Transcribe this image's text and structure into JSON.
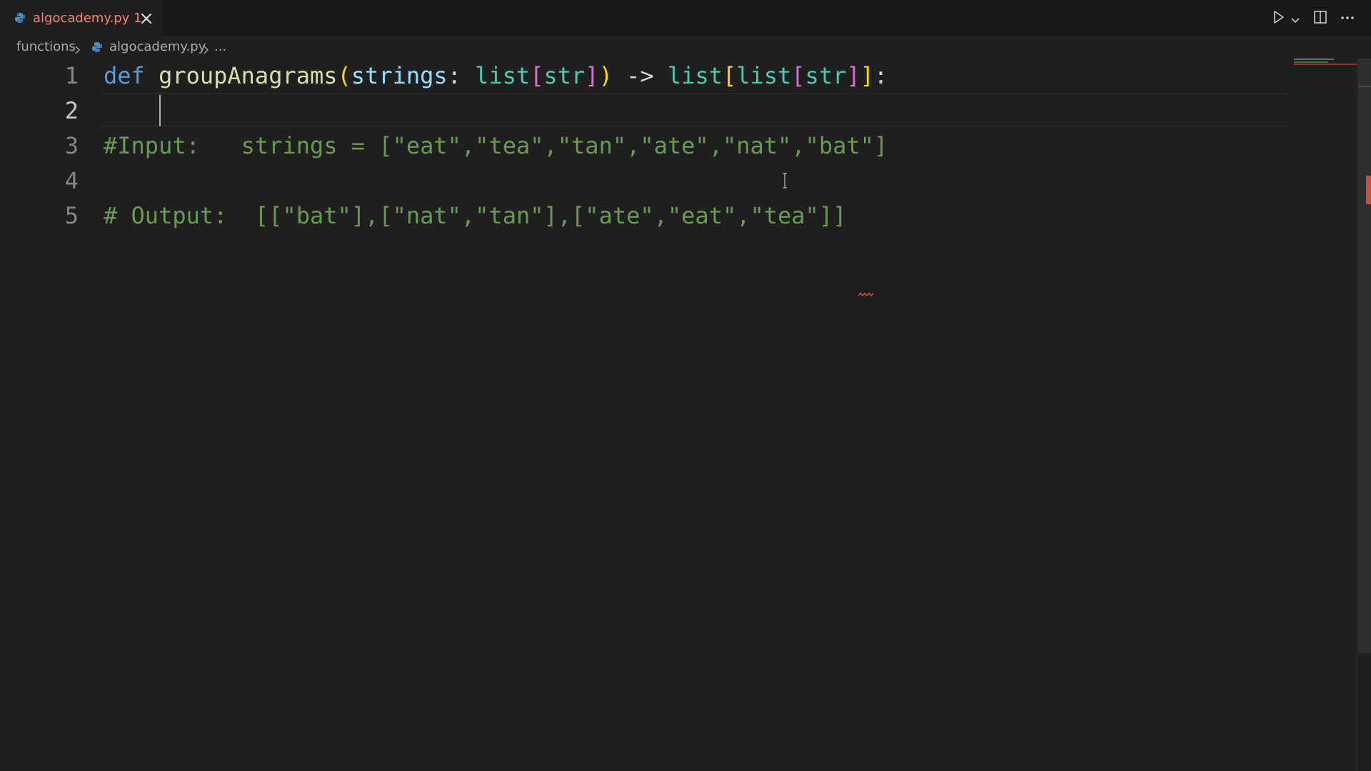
{
  "tab": {
    "filename": "algocademy.py",
    "problem_count": "1",
    "label": "algocademy.py 1",
    "icon": "python-icon"
  },
  "toolbar": {
    "run_icon": "play-icon",
    "run_menu_icon": "chevron-down-icon",
    "split_icon": "split-editor-icon",
    "more_icon": "ellipsis-icon"
  },
  "breadcrumb": {
    "folder": "functions",
    "file": "algocademy.py",
    "symbol": "..."
  },
  "editor": {
    "line_numbers": [
      "1",
      "2",
      "3",
      "4",
      "5"
    ],
    "active_line": "2",
    "lines": {
      "l1": {
        "kw": "def",
        "fn": "groupAnagrams",
        "open_paren": "(",
        "param": "strings",
        "colon": ":",
        "type_list": "list",
        "br_open": "[",
        "type_str": "str",
        "br_close": "]",
        "close_paren": ")",
        "arrow": "->",
        "ret_list1": "list",
        "ret_br1_open": "[",
        "ret_list2": "list",
        "ret_br2_open": "[",
        "ret_str": "str",
        "ret_br2_close": "]",
        "ret_br1_close": "]",
        "end_colon": ":"
      },
      "l3": "#Input:   strings = [\"eat\",\"tea\",\"tan\",\"ate\",\"nat\",\"bat\"]",
      "l5": "# Output:  [[\"bat\"],[\"nat\",\"tan\"],[\"ate\",\"eat\",\"tea\"]]"
    }
  },
  "colors": {
    "background": "#1f1f1f",
    "tab_error_text": "#f48771",
    "keyword": "#569cd6",
    "function": "#dcdcaa",
    "comment": "#6a9955",
    "type": "#4ec9b0"
  }
}
